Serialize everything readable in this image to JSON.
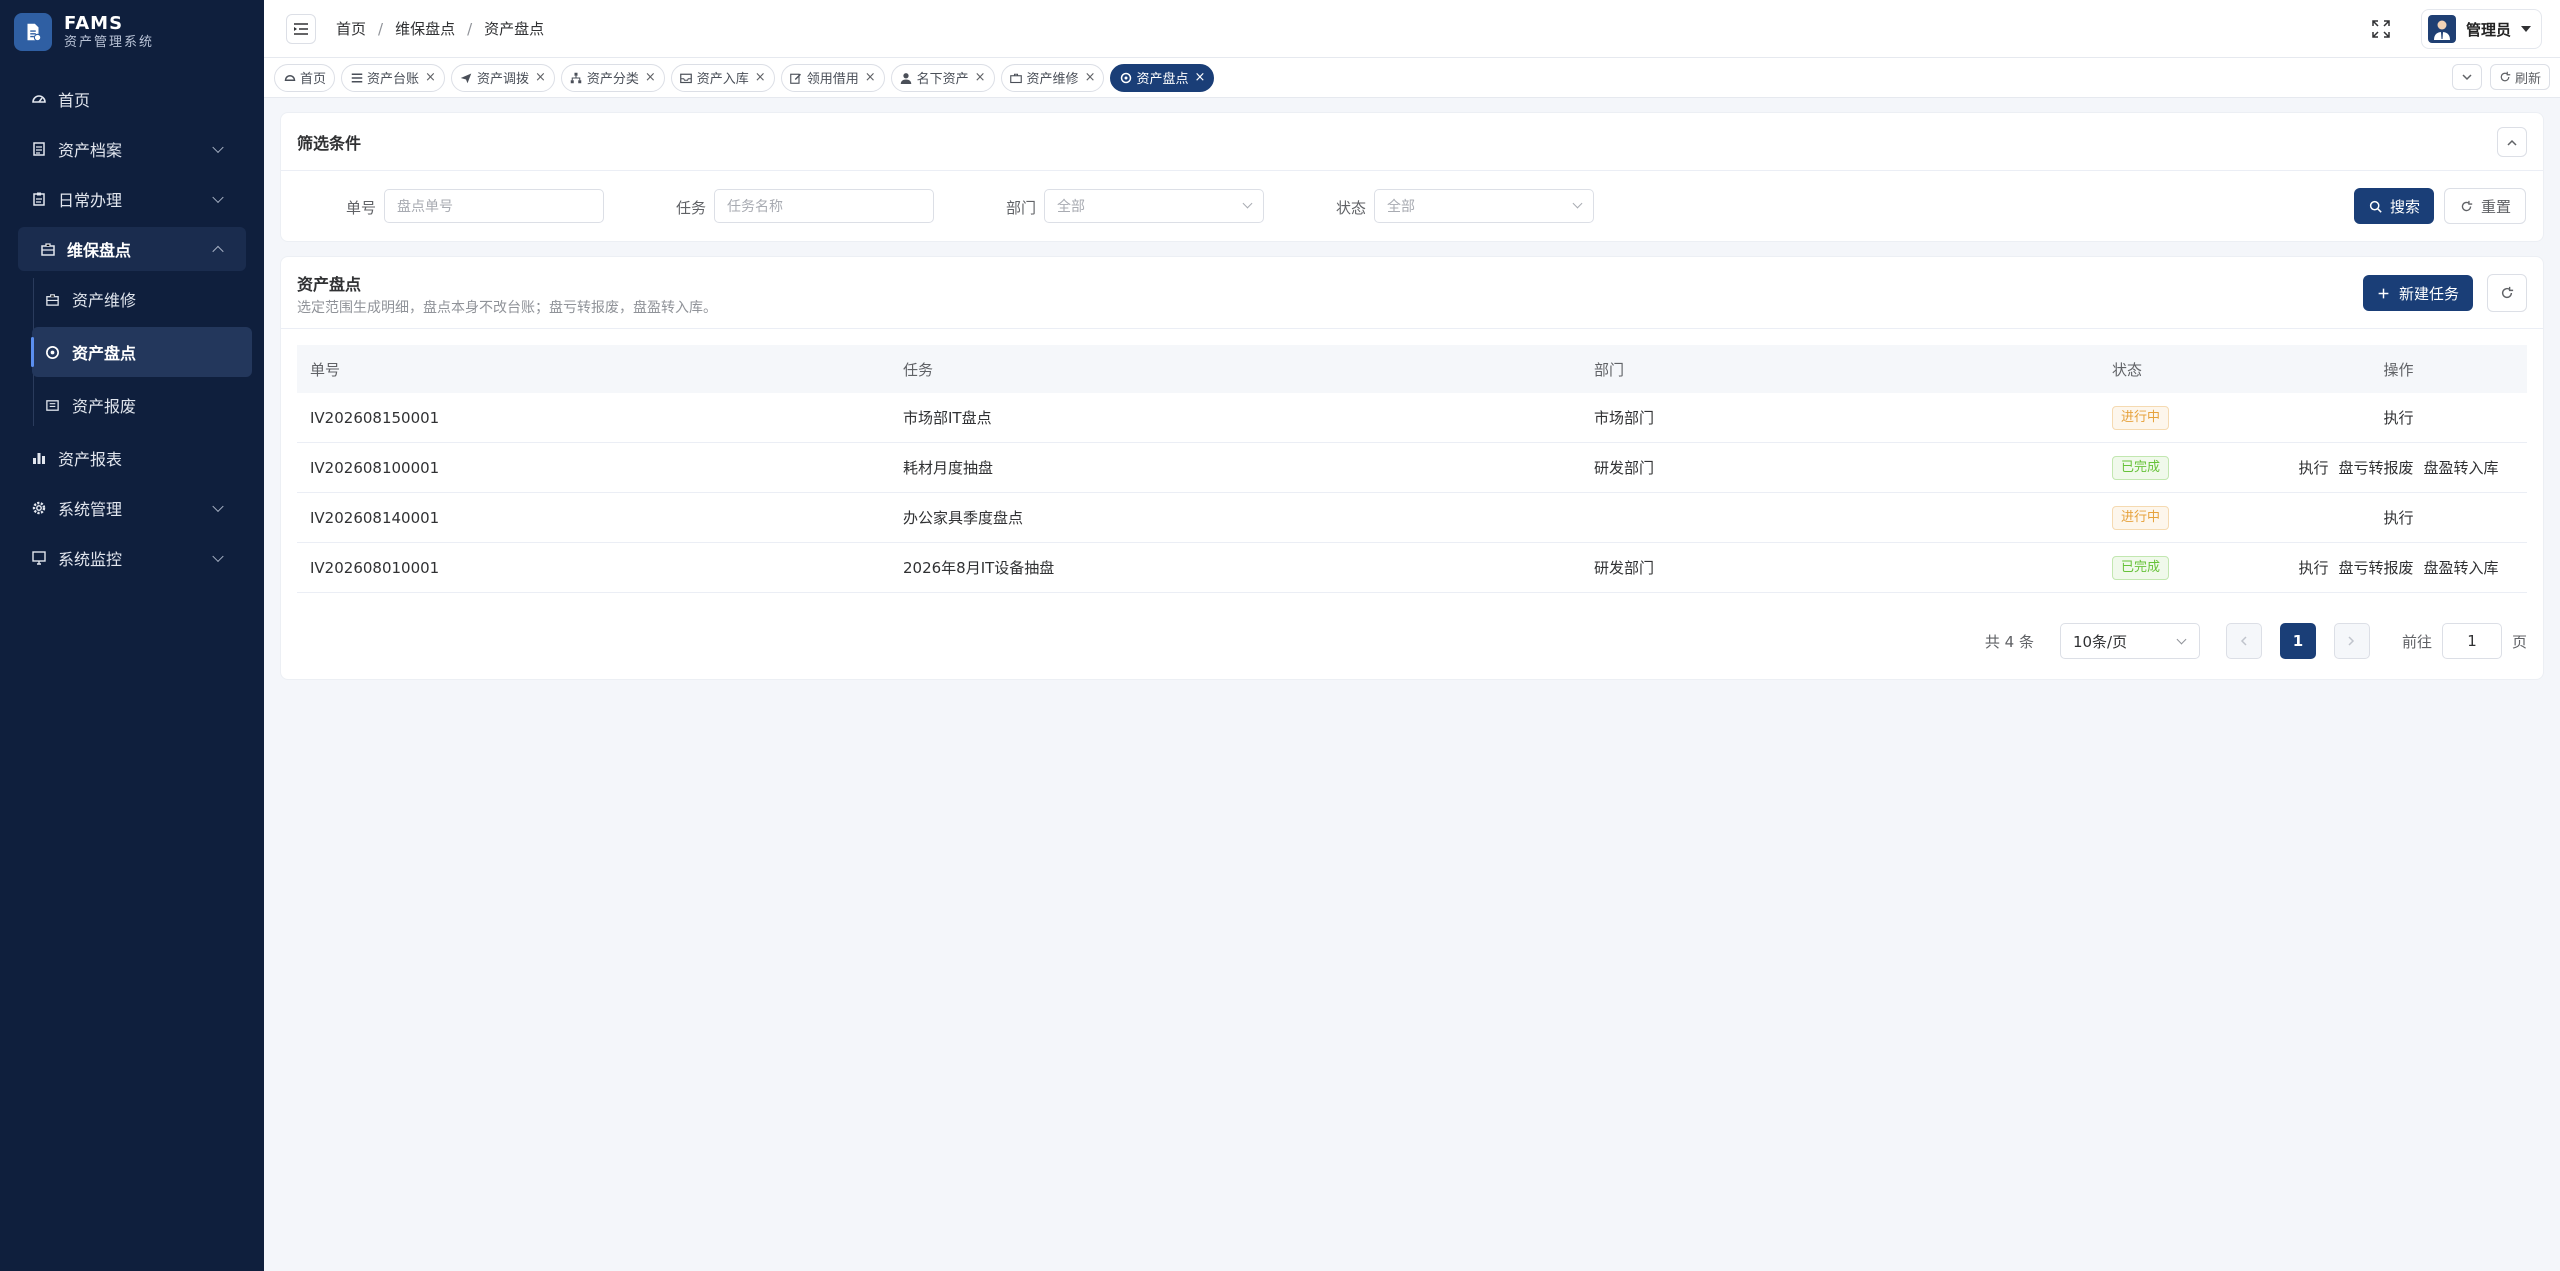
{
  "app": {
    "title": "FAMS",
    "subtitle": "资产管理系统"
  },
  "sidebar": {
    "items": [
      {
        "label": "首页",
        "icon": "dashboard-icon"
      },
      {
        "label": "资产档案",
        "icon": "document-icon"
      },
      {
        "label": "日常办理",
        "icon": "clipboard-icon"
      },
      {
        "label": "维保盘点",
        "icon": "briefcase-icon"
      },
      {
        "label": "资产报表",
        "icon": "bar-chart-icon"
      },
      {
        "label": "系统管理",
        "icon": "gear-icon"
      },
      {
        "label": "系统监控",
        "icon": "monitor-icon"
      }
    ],
    "sub": [
      {
        "label": "资产维修",
        "icon": "toolbox-icon"
      },
      {
        "label": "资产盘点",
        "icon": "target-icon"
      },
      {
        "label": "资产报废",
        "icon": "trash-box-icon"
      }
    ]
  },
  "header": {
    "breadcrumb": [
      "首页",
      "维保盘点",
      "资产盘点"
    ],
    "user": "管理员"
  },
  "tabs": {
    "items": [
      "首页",
      "资产台账",
      "资产调拨",
      "资产分类",
      "资产入库",
      "领用借用",
      "名下资产",
      "资产维修",
      "资产盘点"
    ],
    "refresh_label": "刷新"
  },
  "filter": {
    "title": "筛选条件",
    "order_label": "单号",
    "order_placeholder": "盘点单号",
    "task_label": "任务",
    "task_placeholder": "任务名称",
    "dept_label": "部门",
    "dept_value": "全部",
    "status_label": "状态",
    "status_value": "全部",
    "search_label": "搜索",
    "reset_label": "重置"
  },
  "table": {
    "title": "资产盘点",
    "subtitle": "选定范围生成明细，盘点本身不改台账；盘亏转报废，盘盈转入库。",
    "new_label": "新建任务",
    "columns": [
      "单号",
      "任务",
      "部门",
      "状态",
      "操作"
    ],
    "rows": [
      {
        "id": "IV202608150001",
        "task": "市场部IT盘点",
        "dept": "市场部门",
        "status": "进行中",
        "ops": [
          "执行"
        ]
      },
      {
        "id": "IV202608100001",
        "task": "耗材月度抽盘",
        "dept": "研发部门",
        "status": "已完成",
        "ops": [
          "执行",
          "盘亏转报废",
          "盘盈转入库"
        ]
      },
      {
        "id": "IV202608140001",
        "task": "办公家具季度盘点",
        "dept": "",
        "status": "进行中",
        "ops": [
          "执行"
        ]
      },
      {
        "id": "IV202608010001",
        "task": "2026年8月IT设备抽盘",
        "dept": "研发部门",
        "status": "已完成",
        "ops": [
          "执行",
          "盘亏转报废",
          "盘盈转入库"
        ]
      }
    ]
  },
  "pager": {
    "total": "共 4 条",
    "size": "10条/页",
    "current": "1",
    "goto_label": "前往",
    "goto_value": "1",
    "page_suffix": "页"
  },
  "colors": {
    "sidebar": "#0f1f3d",
    "primary": "#1a3e77",
    "ongoing": "#e6a23c",
    "done": "#67c23a"
  }
}
